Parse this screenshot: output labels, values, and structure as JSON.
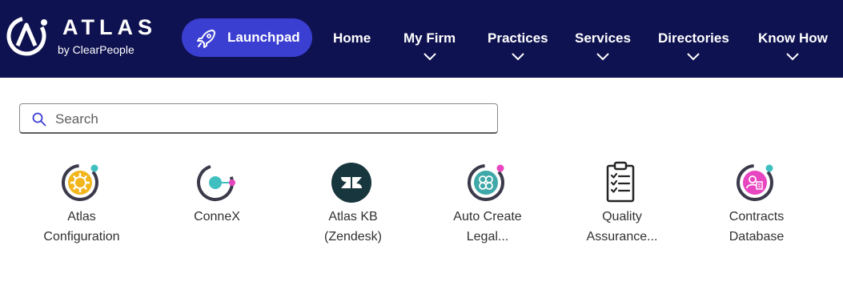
{
  "brand": {
    "name": "ATLAS",
    "byline": "by ClearPeople"
  },
  "nav": {
    "launchpad": "Launchpad",
    "items": [
      {
        "label": "Home",
        "has_dropdown": false
      },
      {
        "label": "My Firm",
        "has_dropdown": true
      },
      {
        "label": "Practices",
        "has_dropdown": true
      },
      {
        "label": "Services",
        "has_dropdown": true
      },
      {
        "label": "Directories",
        "has_dropdown": true
      },
      {
        "label": "Know How",
        "has_dropdown": true
      }
    ]
  },
  "search": {
    "placeholder": "Search",
    "value": ""
  },
  "apps": [
    {
      "line1": "Atlas",
      "line2": "Configuration",
      "icon": "gear-app-icon"
    },
    {
      "line1": "ConneX",
      "line2": "",
      "icon": "connex-app-icon"
    },
    {
      "line1": "Atlas KB",
      "line2": "(Zendesk)",
      "icon": "zendesk-app-icon"
    },
    {
      "line1": "Auto Create",
      "line2": "Legal...",
      "icon": "auto-create-app-icon"
    },
    {
      "line1": "Quality",
      "line2": "Assurance...",
      "icon": "checklist-app-icon"
    },
    {
      "line1": "Contracts",
      "line2": "Database",
      "icon": "contracts-app-icon"
    }
  ],
  "colors": {
    "topbar": "#0f1250",
    "launchpad": "#3b3fd1",
    "accent_teal": "#3fbfbf",
    "accent_pink": "#e845c0",
    "accent_yellow": "#f3b51c"
  }
}
